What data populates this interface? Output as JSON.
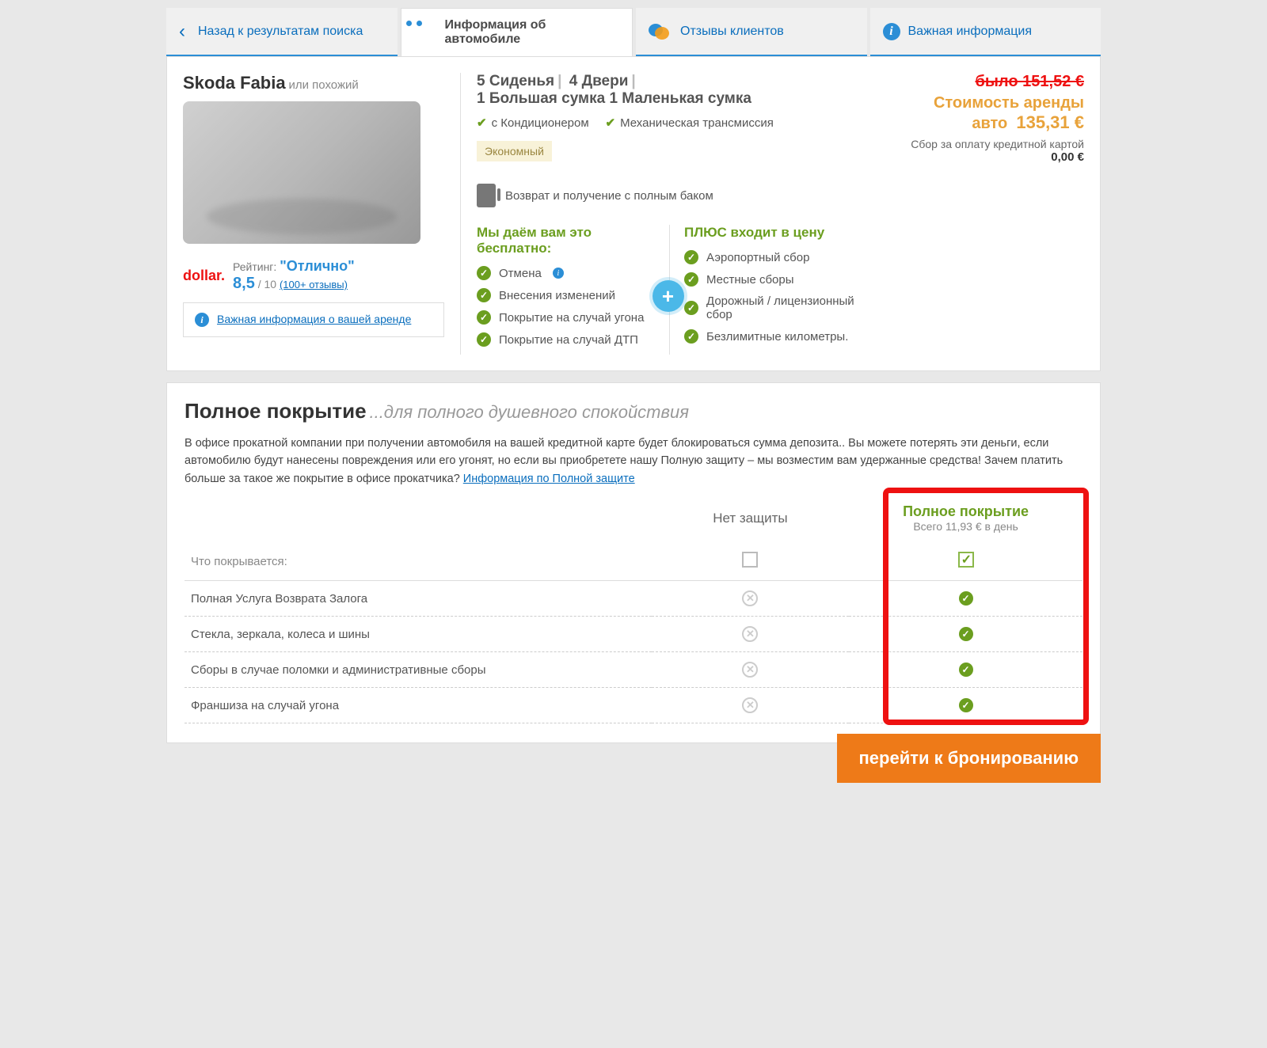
{
  "tabs": {
    "back": "Назад к результатам поиска",
    "info": "Информация об автомобиле",
    "reviews": "Отзывы клиентов",
    "important": "Важная информация"
  },
  "car": {
    "name": "Skoda Fabia",
    "similar": "или похожий",
    "supplier": "dollar.",
    "rating_label": "Рейтинг:",
    "rating_text": "\"Отлично\"",
    "rating_score": "8,5",
    "rating_max": "/ 10",
    "reviews_link": "(100+ отзывы)",
    "important_link": "Важная информация о вашей аренде"
  },
  "specs": {
    "seats": "5 Сиденья",
    "doors": "4 Двери",
    "big_bag": "1 Большая сумка",
    "small_bag": "1 Маленькая сумка",
    "ac": "с Кондиционером",
    "trans": "Механическая трансмиссия",
    "class": "Экономный",
    "fuel": "Возврат и получение с полным баком"
  },
  "free": {
    "title": "Мы даём вам это бесплатно:",
    "items": [
      "Отмена",
      "Внесения изменений",
      "Покрытие на случай угона",
      "Покрытие на случай ДТП"
    ],
    "plus_title": "ПЛЮС входит в цену",
    "plus_items": [
      "Аэропортный сбор",
      "Местные сборы",
      "Дорожный / лицензионный сбор",
      "Безлимитные километры."
    ]
  },
  "price": {
    "was": "было 151,52 €",
    "label": "Стоимость аренды авто",
    "now": "135,31 €",
    "fee_label": "Сбор за оплату кредитной картой",
    "fee_val": "0,00 €"
  },
  "coverage": {
    "title": "Полное покрытие",
    "subtitle": "...для полного душевного спокойствия",
    "desc": "В офисе прокатной компании при получении автомобиля на вашей кредитной карте будет блокироваться сумма депозита..  Вы можете потерять эти деньги, если автомобилю будут нанесены повреждения или его угонят, но если вы приобретете нашу Полную защиту – мы возместим вам удержанные средства!  Зачем платить больше за такое же покрытие в офисе прокатчика?  ",
    "link": "Информация по Полной защите",
    "col_no": "Нет защиты",
    "col_full": "Полное покрытие",
    "col_full_sub": "Всего 11,93 € в день",
    "row_label": "Что покрывается:",
    "rows": [
      "Полная Услуга Возврата Залога",
      "Стекла, зеркала, колеса и шины",
      "Сборы в случае поломки и административные сборы",
      "Франшиза на случай угона"
    ]
  },
  "cta": "перейти к бронированию"
}
